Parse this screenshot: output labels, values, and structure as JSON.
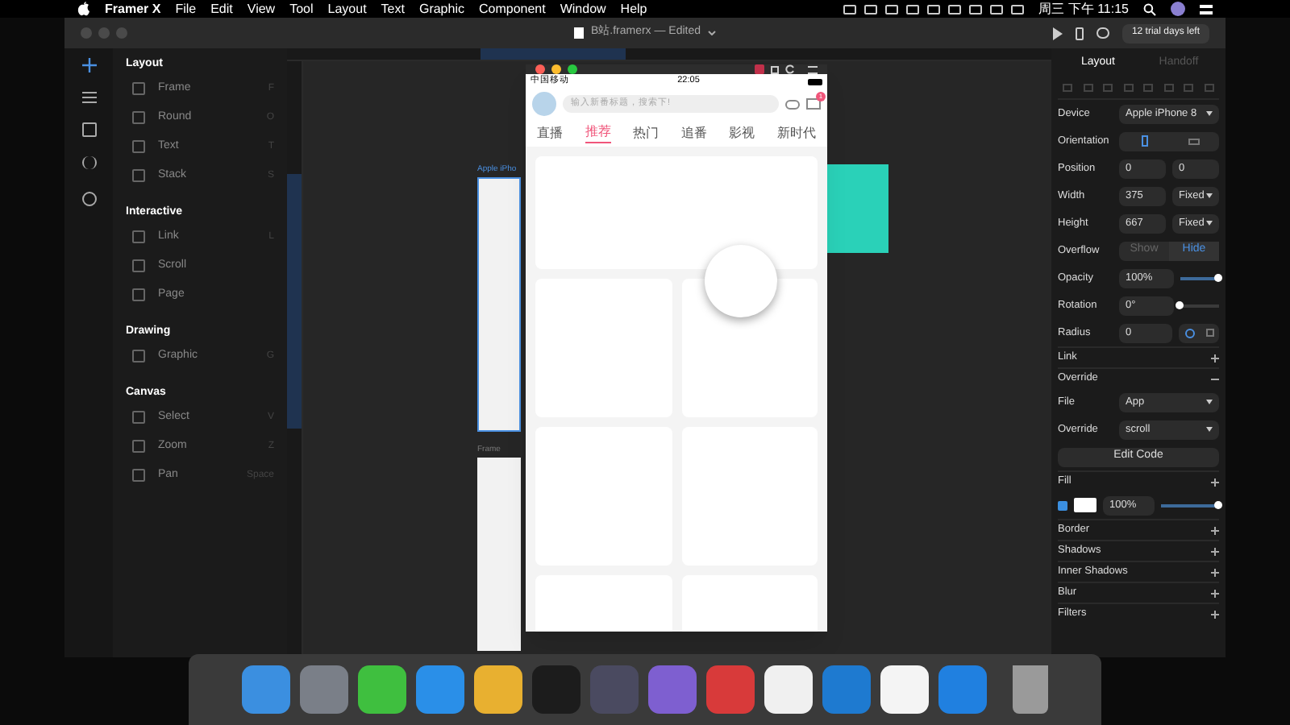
{
  "menubar": {
    "app": "Framer X",
    "menus": [
      "File",
      "Edit",
      "View",
      "Tool",
      "Layout",
      "Text",
      "Graphic",
      "Component",
      "Window",
      "Help"
    ],
    "clock": "周三 下午 11:15"
  },
  "window": {
    "title": "B站.framerx — Edited",
    "trial": "12 trial days left"
  },
  "sidebar": {
    "sections": [
      {
        "title": "Layout",
        "items": [
          {
            "label": "Frame",
            "shortcut": "F"
          },
          {
            "label": "Round",
            "shortcut": "O"
          },
          {
            "label": "Text",
            "shortcut": "T"
          },
          {
            "label": "Stack",
            "shortcut": "S"
          }
        ]
      },
      {
        "title": "Interactive",
        "items": [
          {
            "label": "Link",
            "shortcut": "L"
          },
          {
            "label": "Scroll"
          },
          {
            "label": "Page"
          }
        ]
      },
      {
        "title": "Drawing",
        "items": [
          {
            "label": "Graphic",
            "shortcut": "G"
          }
        ]
      },
      {
        "title": "Canvas",
        "items": [
          {
            "label": "Select",
            "shortcut": "V"
          },
          {
            "label": "Zoom",
            "shortcut": "Z"
          },
          {
            "label": "Pan",
            "shortcut": "Space"
          }
        ]
      }
    ]
  },
  "canvas": {
    "frames": [
      {
        "label": "Apple iPho",
        "selected": true
      },
      {
        "label": "Frame",
        "selected": false
      }
    ]
  },
  "preview": {
    "carrier": "中国移动",
    "time": "22:05",
    "search": {
      "placeholder": "输入新番标题，搜索下!"
    },
    "tabs": [
      {
        "label": "直播",
        "selected": false
      },
      {
        "label": "推荐",
        "selected": true
      },
      {
        "label": "热门",
        "selected": false
      },
      {
        "label": "追番",
        "selected": false
      },
      {
        "label": "影视",
        "selected": false
      },
      {
        "label": "新时代",
        "selected": false
      }
    ],
    "mail_badge": "1"
  },
  "panel": {
    "tabs": [
      {
        "label": "Layout",
        "selected": true
      },
      {
        "label": "Handoff",
        "selected": false
      }
    ],
    "rows": [
      {
        "kind": "select",
        "label": "Device",
        "value": "Apple iPhone 8"
      },
      {
        "kind": "icons",
        "label": "Orientation",
        "options": [
          {
            "selected": true
          },
          {
            "selected": false
          }
        ]
      },
      {
        "kind": "pair",
        "label": "Position",
        "values": [
          "0",
          "0"
        ]
      },
      {
        "kind": "input_select",
        "label": "Width",
        "value": "375",
        "option": "Fixed"
      },
      {
        "kind": "input_select",
        "label": "Height",
        "value": "667",
        "option": "Fixed"
      },
      {
        "kind": "segment",
        "label": "Overflow",
        "options": [
          {
            "label": "Show",
            "selected": false
          },
          {
            "label": "Hide",
            "selected": true
          }
        ]
      },
      {
        "kind": "slider",
        "label": "Opacity",
        "value": "100%",
        "level": 1
      },
      {
        "kind": "slider",
        "label": "Rotation",
        "value": "0°",
        "level": 0
      },
      {
        "kind": "radius",
        "label": "Radius",
        "value": "0"
      },
      {
        "kind": "section",
        "label": "Link",
        "expanded": false
      },
      {
        "kind": "section",
        "label": "Override",
        "expanded": true
      },
      {
        "kind": "select",
        "label": "File",
        "value": "App"
      },
      {
        "kind": "select",
        "label": "Override",
        "value": "scroll"
      },
      {
        "kind": "button",
        "label": "Edit Code"
      },
      {
        "kind": "section",
        "label": "Fill",
        "expanded": false
      },
      {
        "kind": "fill",
        "checked": true,
        "value": "100%",
        "level": 1
      },
      {
        "kind": "section",
        "label": "Border",
        "expanded": false
      },
      {
        "kind": "section",
        "label": "Shadows",
        "expanded": false
      },
      {
        "kind": "section",
        "label": "Inner Shadows",
        "expanded": false
      },
      {
        "kind": "section",
        "label": "Blur",
        "expanded": false
      },
      {
        "kind": "section",
        "label": "Filters",
        "expanded": false
      }
    ]
  },
  "dock": [
    {
      "color": "#3b8fe0"
    },
    {
      "color": "#7a7f88"
    },
    {
      "color": "#3fbf3f"
    },
    {
      "color": "#2a8fe8"
    },
    {
      "color": "#e8b030"
    },
    {
      "color": "#1c1c1c"
    },
    {
      "color": "#4a4a60"
    },
    {
      "color": "#7e5fd0"
    },
    {
      "color": "#d83a3a"
    },
    {
      "color": "#f0f0f0"
    },
    {
      "color": "#1e7ad0"
    },
    {
      "color": "#f4f4f4"
    },
    {
      "color": "#2080e0"
    }
  ]
}
